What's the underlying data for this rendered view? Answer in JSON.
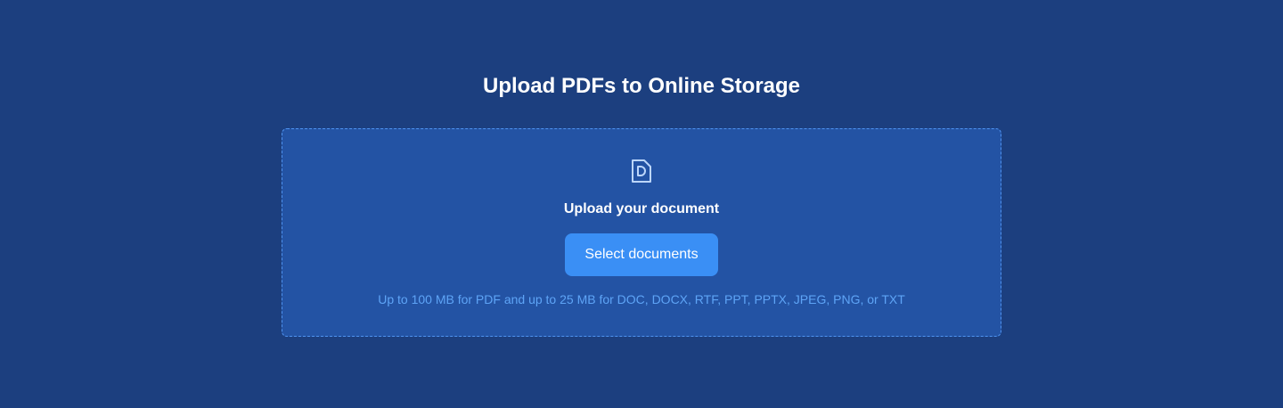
{
  "page": {
    "title": "Upload PDFs to Online Storage"
  },
  "dropzone": {
    "icon": "document-icon",
    "label": "Upload your document",
    "button_label": "Select documents",
    "hint": "Up to 100 MB for PDF and up to 25 MB for DOC, DOCX, RTF, PPT, PPTX, JPEG, PNG, or TXT"
  },
  "colors": {
    "background": "#1c3f7f",
    "dropzone_fill": "#2353a4",
    "dropzone_border": "#4f93f0",
    "button": "#3a8ff5",
    "hint_text": "#5ea4f6",
    "text": "#ffffff"
  }
}
